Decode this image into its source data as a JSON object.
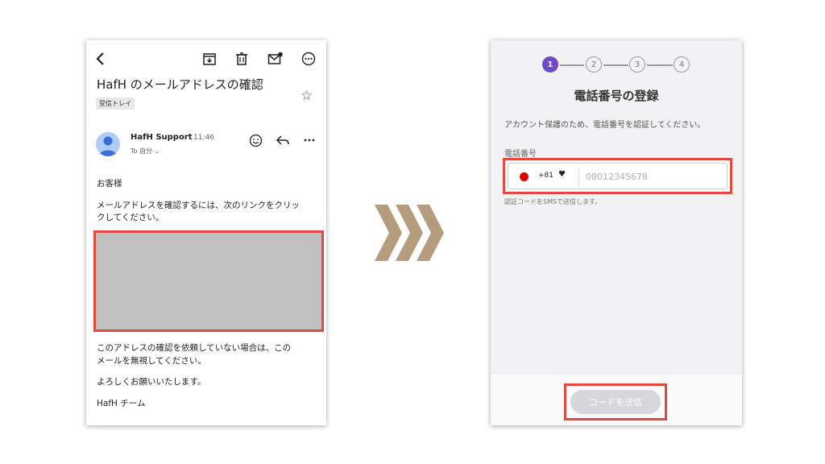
{
  "email": {
    "subject": "HafH のメールアドレスの確認",
    "label_chip": "受信トレイ",
    "sender_name": "HafH Support",
    "time": "11:46",
    "to_line": "To 自分 ⌄",
    "body": {
      "greeting": "お客様",
      "instruction_line1": "メールアドレスを確認するには、次のリンクをクリッ",
      "instruction_line2": "クしてください。",
      "notice_line1": "このアドレスの確認を依頼していない場合は、この",
      "notice_line2": "メールを無視してください。",
      "regards": "よろしくお願いいたします。",
      "signature": "HafH チーム"
    },
    "icons": [
      "back-icon",
      "archive-icon",
      "trash-icon",
      "mark-unread-icon",
      "more-icon",
      "star-icon",
      "emoji-icon",
      "reply-icon",
      "more-horizontal-icon"
    ]
  },
  "registration": {
    "steps": [
      "1",
      "2",
      "3",
      "4"
    ],
    "active_step": 1,
    "title": "電話番号の登録",
    "description": "アカウント保護のため、電話番号を認証してください。",
    "field_label": "電話番号",
    "country_code": "+81",
    "phone_placeholder": "08012345678",
    "hint": "認証コードをSMSで送信します。",
    "send_button": "コードを送信"
  },
  "colors": {
    "highlight": "#e04a3f",
    "accent": "#6c4ac9",
    "chevron": "#b49c7d",
    "redacted": "#c0c0c0"
  }
}
